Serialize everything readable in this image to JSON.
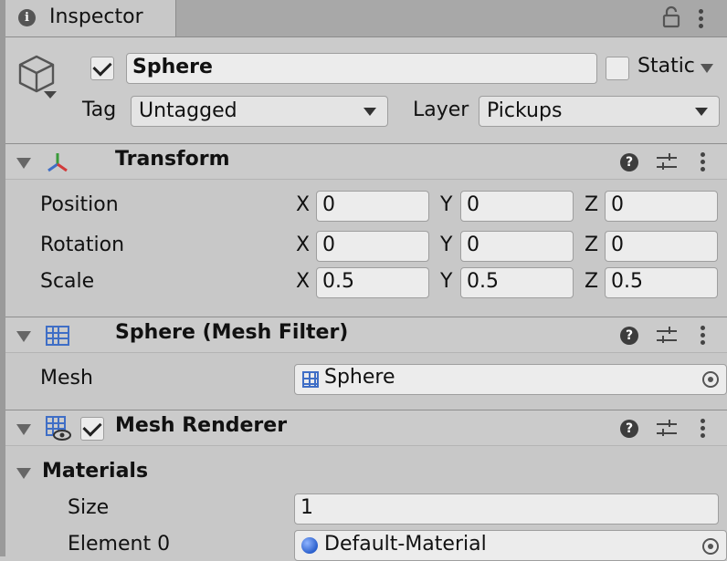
{
  "tab": {
    "title": "Inspector"
  },
  "object": {
    "active": true,
    "name": "Sphere",
    "static_label": "Static",
    "tag_label": "Tag",
    "tag_value": "Untagged",
    "layer_label": "Layer",
    "layer_value": "Pickups"
  },
  "transform": {
    "title": "Transform",
    "rows": [
      {
        "label": "Position",
        "x": "0",
        "y": "0",
        "z": "0"
      },
      {
        "label": "Rotation",
        "x": "0",
        "y": "0",
        "z": "0"
      },
      {
        "label": "Scale",
        "x": "0.5",
        "y": "0.5",
        "z": "0.5"
      }
    ],
    "axis": {
      "x": "X",
      "y": "Y",
      "z": "Z"
    }
  },
  "mesh_filter": {
    "title": "Sphere (Mesh Filter)",
    "mesh_label": "Mesh",
    "mesh_value": "Sphere"
  },
  "mesh_renderer": {
    "enabled": true,
    "title": "Mesh Renderer",
    "materials_label": "Materials",
    "size_label": "Size",
    "size_value": "1",
    "element0_label": "Element 0",
    "element0_value": "Default-Material"
  },
  "colors": {
    "accent_blue": "#3f6ec6",
    "panel_bg": "#c8c8c8",
    "field_bg": "#ececec"
  },
  "icons": [
    "info-icon",
    "lock-icon",
    "kebab-menu-icon",
    "cube-icon",
    "dropdown-arrow-icon",
    "transform-axes-icon",
    "help-icon",
    "preset-sliders-icon",
    "mesh-grid-icon",
    "object-picker-icon",
    "material-sphere-icon",
    "foldout-arrow-icon",
    "checkmark-icon"
  ]
}
